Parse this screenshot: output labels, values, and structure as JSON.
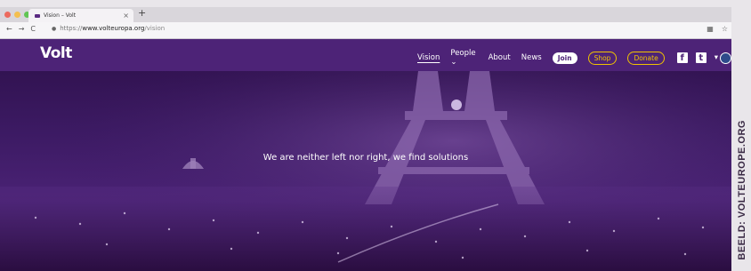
{
  "browser": {
    "tab_title": "Vision – Volt",
    "tab_close": "×",
    "new_tab": "+",
    "nav_back": "←",
    "nav_forward": "→",
    "nav_reload": "C",
    "url_scheme": "https://",
    "url_domain": "www.volteuropa.org",
    "url_path": "/vision",
    "traffic_colors": [
      "#ec6a5e",
      "#f4bf4f",
      "#61c554"
    ]
  },
  "site": {
    "logo": "Volt",
    "nav": {
      "vision": "Vision",
      "people": "People",
      "people_caret": "⌄",
      "about": "About",
      "news": "News",
      "join": "Join",
      "shop": "Shop",
      "donate": "Donate",
      "facebook": "f",
      "twitter": "t",
      "lang_caret": "▾"
    },
    "colors": {
      "brand_purple": "#4d2377",
      "accent_yellow": "#f1c400"
    }
  },
  "hero": {
    "tagline": "We are neither left nor right, we find solutions"
  },
  "image_credit": "BEELD: VOLTEUROPE.ORG"
}
